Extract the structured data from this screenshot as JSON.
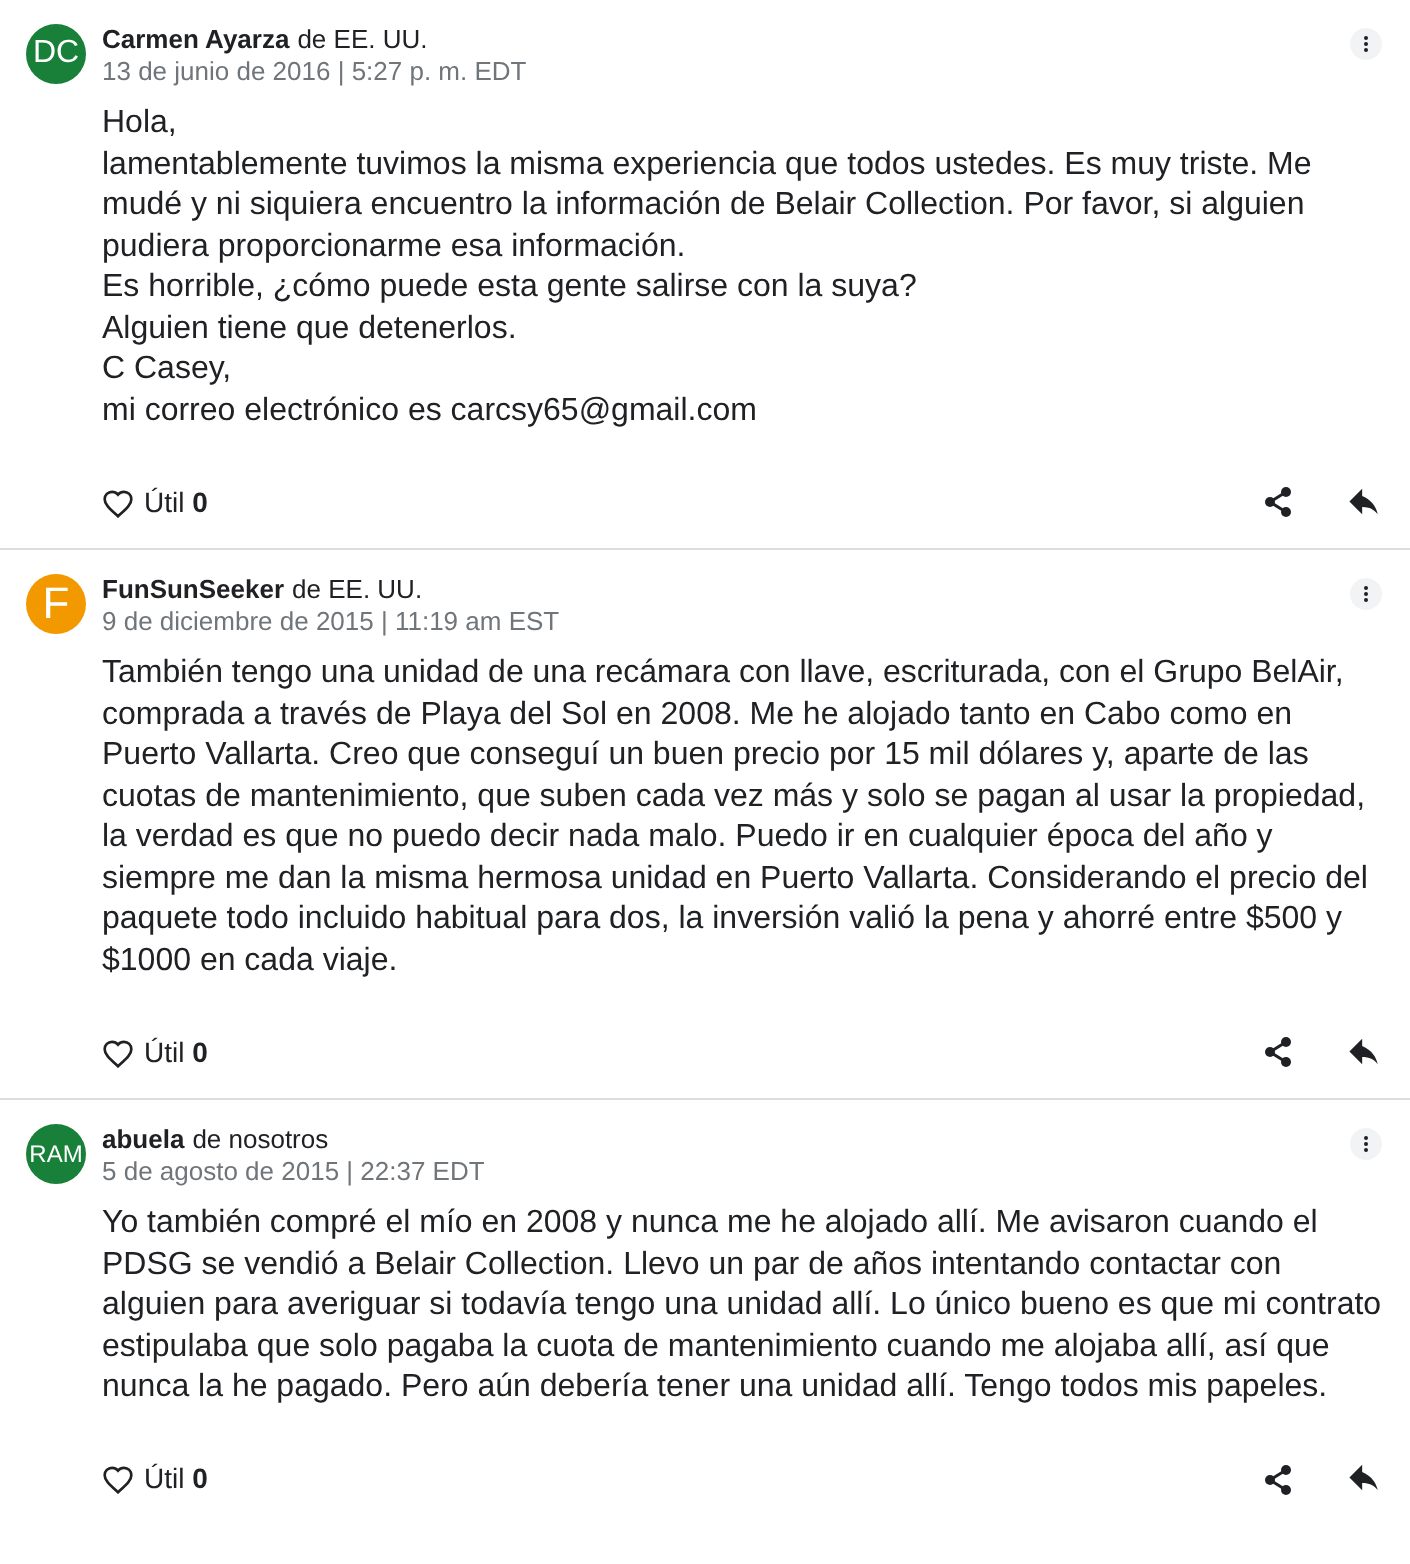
{
  "reviews": [
    {
      "avatar": {
        "initials": "DC",
        "color": "#188038"
      },
      "author": "Carmen Ayarza",
      "location": "de EE. UU.",
      "date": "13 de junio de 2016 | 5:27 p. m. EDT",
      "paragraphs": [
        "Hola,",
        "lamentablemente tuvimos la misma experiencia que todos ustedes. Es muy triste. Me mudé y ni siquiera encuentro la información de Belair Collection. Por favor, si alguien pudiera proporcionarme esa información.",
        "Es horrible, ¿cómo puede esta gente salirse con la suya?",
        "Alguien tiene que detenerlos.",
        "C Casey,",
        "mi correo electrónico es carcsy65@gmail.com"
      ],
      "helpful_label": "Útil",
      "helpful_count": "0"
    },
    {
      "avatar": {
        "initials": "F",
        "color": "#f29900"
      },
      "author": "FunSunSeeker",
      "location": "de EE. UU.",
      "date": "9 de diciembre de 2015 | 11:19 am EST",
      "paragraphs": [
        "También tengo una unidad de una recámara con llave, escriturada, con el Grupo BelAir, comprada a través de Playa del Sol en 2008. Me he alojado tanto en Cabo como en Puerto Vallarta. Creo que conseguí un buen precio por 15 mil dólares y, aparte de las cuotas de mantenimiento, que suben cada vez más y solo se pagan al usar la propiedad, la verdad es que no puedo decir nada malo. Puedo ir en cualquier época del año y siempre me dan la misma hermosa unidad en Puerto Vallarta. Considerando el precio del paquete todo incluido habitual para dos, la inversión valió la pena y ahorré entre $500 y $1000 en cada viaje."
      ],
      "helpful_label": "Útil",
      "helpful_count": "0"
    },
    {
      "avatar": {
        "initials": "RAM",
        "color": "#188038"
      },
      "author": "abuela",
      "location": "de nosotros",
      "date": "5 de agosto de 2015 | 22:37 EDT",
      "paragraphs": [
        "Yo también compré el mío en 2008 y nunca me he alojado allí. Me avisaron cuando el PDSG se vendió a Belair Collection. Llevo un par de años intentando contactar con alguien para averiguar si todavía tengo una unidad allí. Lo único bueno es que mi contrato estipulaba que solo pagaba la cuota de mantenimiento cuando me alojaba allí, así que nunca la he pagado. Pero aún debería tener una unidad allí. Tengo todos mis papeles."
      ],
      "helpful_label": "Útil",
      "helpful_count": "0"
    }
  ]
}
